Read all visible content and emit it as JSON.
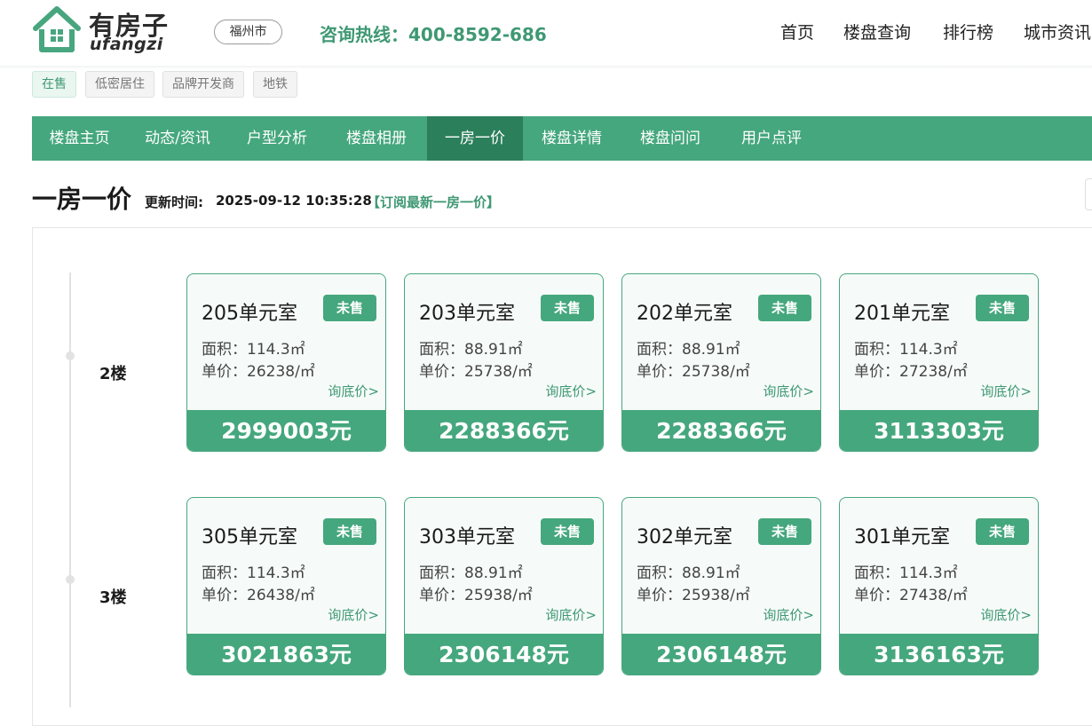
{
  "brand": {
    "name_cn": "有房子",
    "name_en": "ufangzi"
  },
  "header": {
    "city": "福州市",
    "hotline": "咨询热线：400-8592-686",
    "nav": [
      "首页",
      "楼盘查询",
      "排行榜",
      "城市资讯"
    ]
  },
  "tags": [
    "在售",
    "低密居住",
    "品牌开发商",
    "地铁"
  ],
  "tabs": [
    "楼盘主页",
    "动态/资讯",
    "户型分析",
    "楼盘相册",
    "一房一价",
    "楼盘详情",
    "楼盘问问",
    "用户点评"
  ],
  "active_tab": "一房一价",
  "section": {
    "title": "一房一价",
    "update_label": "更新时间:",
    "update_time": "2025-09-12 10:35:28",
    "subscribe": "【订阅最新一房一价】"
  },
  "floors": [
    {
      "label": "2楼",
      "units": [
        {
          "room": "205单元室",
          "status": "未售",
          "area": "面积：114.3㎡",
          "unit_price": "单价：26238/㎡",
          "ask": "询底价>",
          "total": "2999003元"
        },
        {
          "room": "203单元室",
          "status": "未售",
          "area": "面积：88.91㎡",
          "unit_price": "单价：25738/㎡",
          "ask": "询底价>",
          "total": "2288366元"
        },
        {
          "room": "202单元室",
          "status": "未售",
          "area": "面积：88.91㎡",
          "unit_price": "单价：25738/㎡",
          "ask": "询底价>",
          "total": "2288366元"
        },
        {
          "room": "201单元室",
          "status": "未售",
          "area": "面积：114.3㎡",
          "unit_price": "单价：27238/㎡",
          "ask": "询底价>",
          "total": "3113303元"
        }
      ]
    },
    {
      "label": "3楼",
      "units": [
        {
          "room": "305单元室",
          "status": "未售",
          "area": "面积：114.3㎡",
          "unit_price": "单价：26438/㎡",
          "ask": "询底价>",
          "total": "3021863元"
        },
        {
          "room": "303单元室",
          "status": "未售",
          "area": "面积：88.91㎡",
          "unit_price": "单价：25938/㎡",
          "ask": "询底价>",
          "total": "2306148元"
        },
        {
          "room": "302单元室",
          "status": "未售",
          "area": "面积：88.91㎡",
          "unit_price": "单价：25938/㎡",
          "ask": "询底价>",
          "total": "2306148元"
        },
        {
          "room": "301单元室",
          "status": "未售",
          "area": "面积：114.3㎡",
          "unit_price": "单价：27438/㎡",
          "ask": "询底价>",
          "total": "3136163元"
        }
      ]
    }
  ],
  "colors": {
    "brand_green": "#45a77d",
    "active_tab": "#2b7f5b",
    "text_green": "#3f9873"
  }
}
